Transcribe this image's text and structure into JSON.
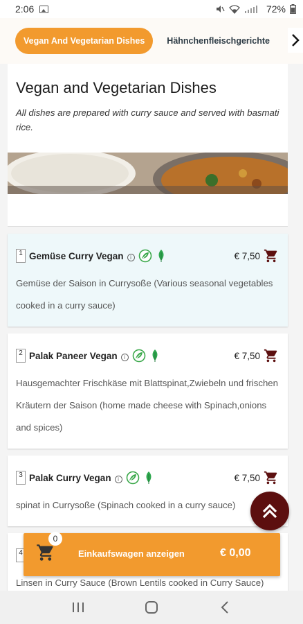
{
  "status_bar": {
    "time": "2:06",
    "battery": "72%"
  },
  "tabs": {
    "active_label": "Vegan And Vegetarian Dishes",
    "next_label": "Hähnchenfleischgerichte"
  },
  "category": {
    "title": "Vegan and Vegetarian Dishes",
    "description": "All dishes are prepared with curry sauce and served with basmati rice."
  },
  "items": [
    {
      "number": "1",
      "name": "Gemüse Curry Vegan",
      "price": "€ 7,50",
      "description": "Gemüse der Saison in Currysoße (Various seasonal vegetables cooked in a curry sauce)"
    },
    {
      "number": "2",
      "name": "Palak Paneer Vegan",
      "price": "€ 7,50",
      "description": "Hausgemachter Frischkäse mit Blattspinat,Zwiebeln und frischen Kräutern der Saison (home made cheese with Spinach,onions and spices)"
    },
    {
      "number": "3",
      "name": "Palak Curry Vegan",
      "price": "€ 7,50",
      "description": "spinat in Currysoße (Spinach cooked in a curry sauce)"
    },
    {
      "number": "4",
      "name": "",
      "price": "",
      "description": "Linsen in Curry Sauce (Brown Lentils cooked in Curry Sauce)"
    }
  ],
  "cart": {
    "count": "0",
    "label": "Einkaufswagen anzeigen",
    "total": "€ 0,00"
  },
  "colors": {
    "accent": "#f29a2e",
    "dark_red": "#5c0f0f",
    "vegan_green": "#3aa84a"
  },
  "icons": [
    "image-icon",
    "mute-icon",
    "wifi-icon",
    "signal-icon",
    "battery-icon",
    "info-icon",
    "vegan-icon",
    "leaf-icon",
    "cart-icon",
    "chevron-right-icon",
    "double-chevron-up-icon",
    "recent-apps-icon",
    "home-icon",
    "back-icon"
  ]
}
